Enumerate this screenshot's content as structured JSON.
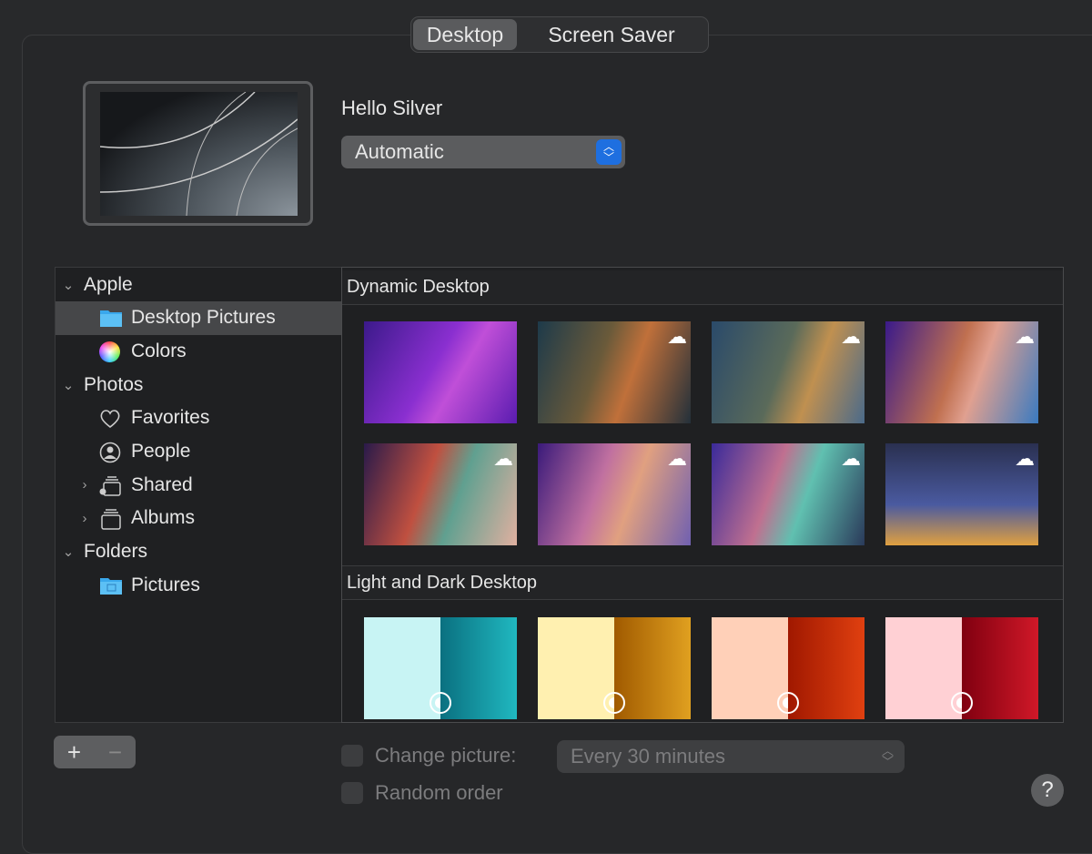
{
  "tabs": [
    {
      "label": "Desktop",
      "active": true
    },
    {
      "label": "Screen Saver",
      "active": false
    }
  ],
  "preview": {
    "name": "Hello Silver",
    "mode": "Automatic"
  },
  "sidebar": [
    {
      "label": "Apple",
      "type": "group",
      "expanded": true
    },
    {
      "label": "Desktop Pictures",
      "icon": "folder-icon",
      "selected": true
    },
    {
      "label": "Colors",
      "icon": "color-wheel-icon"
    },
    {
      "label": "Photos",
      "type": "group",
      "expanded": true
    },
    {
      "label": "Favorites",
      "icon": "heart-icon"
    },
    {
      "label": "People",
      "icon": "person-circle-icon"
    },
    {
      "label": "Shared",
      "icon": "shared-album-icon",
      "collapsible": true
    },
    {
      "label": "Albums",
      "icon": "albums-icon",
      "collapsible": true
    },
    {
      "label": "Folders",
      "type": "group",
      "expanded": true
    },
    {
      "label": "Pictures",
      "icon": "pictures-folder-icon"
    }
  ],
  "sections": [
    {
      "title": "Dynamic Desktop"
    },
    {
      "title": "Light and Dark Desktop"
    }
  ],
  "controls": {
    "add": "+",
    "remove": "−",
    "change_picture": "Change picture:",
    "interval": "Every 30 minutes",
    "random_order": "Random order",
    "help": "?"
  },
  "colors": {
    "accent": "#1e6fe0",
    "selection": "#464749"
  }
}
